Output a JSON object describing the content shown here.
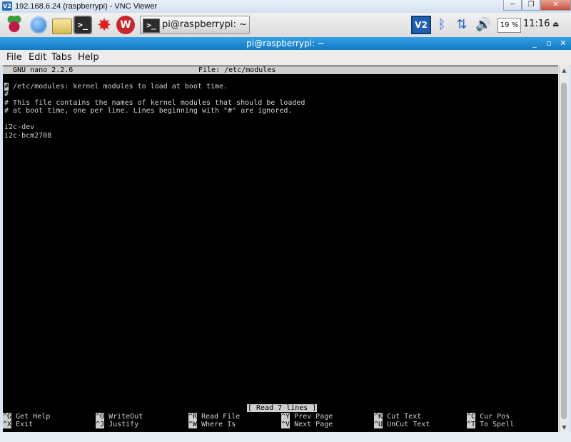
{
  "vnc_window": {
    "logo": "V2",
    "title": "192.168.6.24 (raspberrypi) - VNC Viewer",
    "buttons": {
      "minimize": "─",
      "maximize": "❐",
      "close": "✕"
    }
  },
  "panel": {
    "launchers": [
      {
        "icon": "raspberry-icon"
      },
      {
        "icon": "globe-icon"
      },
      {
        "icon": "folder-icon"
      },
      {
        "icon": "terminal-icon",
        "glyph": ">_"
      },
      {
        "icon": "burst-icon",
        "glyph": "✸"
      },
      {
        "icon": "wolf-icon",
        "glyph": "W"
      }
    ],
    "task": {
      "icon_glyph": ">_",
      "label": "pi@raspberrypi: ~"
    },
    "tray": {
      "vnc_glyph": "V2",
      "bluetooth_glyph": "ᛒ",
      "network_glyph": "⇅",
      "volume_glyph": "🔊",
      "cpu": "19 %",
      "clock": "11:16",
      "eject_glyph": "⏏"
    }
  },
  "terminal": {
    "title": "pi@raspberrypi: ~",
    "title_buttons": {
      "minimize": "_",
      "maximize": "▫",
      "close": "✕"
    },
    "menu": [
      "File",
      "Edit",
      "Tabs",
      "Help"
    ]
  },
  "nano": {
    "version": "GNU nano 2.2.6",
    "file": "File: /etc/modules",
    "lines": [
      " /etc/modules: kernel modules to load at boot time.",
      "#",
      "# This file contains the names of kernel modules that should be loaded",
      "# at boot time, one per line. Lines beginning with \"#\" are ignored.",
      "",
      "i2c-dev",
      "i2c-bcm2708"
    ],
    "cursor_char": "#",
    "status": "[ Read 7 lines ]",
    "shortcuts_row1": [
      {
        "key": "^G",
        "label": "Get Help"
      },
      {
        "key": "^O",
        "label": "WriteOut"
      },
      {
        "key": "^R",
        "label": "Read File"
      },
      {
        "key": "^Y",
        "label": "Prev Page"
      },
      {
        "key": "^K",
        "label": "Cut Text"
      },
      {
        "key": "^C",
        "label": "Cur Pos"
      }
    ],
    "shortcuts_row2": [
      {
        "key": "^X",
        "label": "Exit"
      },
      {
        "key": "^J",
        "label": "Justify"
      },
      {
        "key": "^W",
        "label": "Where Is"
      },
      {
        "key": "^V",
        "label": "Next Page"
      },
      {
        "key": "^U",
        "label": "UnCut Text"
      },
      {
        "key": "^T",
        "label": "To Spell"
      }
    ]
  },
  "scrollbar": {
    "up": "▲",
    "down": "▼"
  }
}
